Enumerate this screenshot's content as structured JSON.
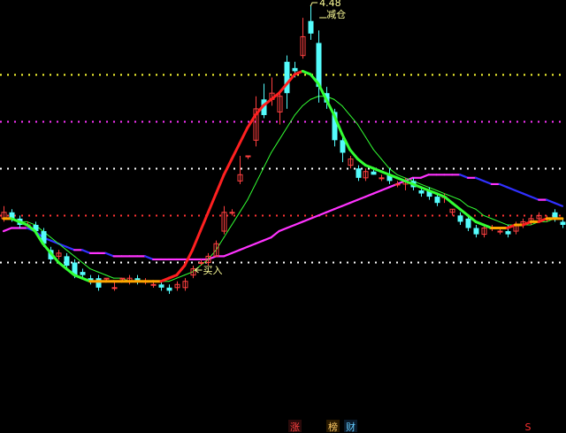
{
  "chart_data": {
    "type": "candlestick",
    "price_range": [
      3.3,
      4.48
    ],
    "annotations": {
      "high_price": "4.48",
      "sell_label": "减仓",
      "buy_label": "买入"
    },
    "guide_lines": [
      {
        "price": 4.26,
        "color": "#ffff33"
      },
      {
        "price": 4.11,
        "color": "#ff33ff"
      },
      {
        "price": 3.96,
        "color": "#ffffff"
      },
      {
        "price": 3.81,
        "color": "#ff3333"
      },
      {
        "price": 3.66,
        "color": "#ffffff"
      }
    ],
    "candles": [
      [
        3.8,
        3.82,
        3.79,
        3.84
      ],
      [
        3.82,
        3.8,
        3.79,
        3.83
      ],
      [
        3.8,
        3.78,
        3.77,
        3.81
      ],
      [
        3.78,
        3.78,
        3.77,
        3.79
      ],
      [
        3.78,
        3.76,
        3.75,
        3.79
      ],
      [
        3.76,
        3.72,
        3.71,
        3.77
      ],
      [
        3.7,
        3.67,
        3.66,
        3.71
      ],
      [
        3.68,
        3.69,
        3.67,
        3.7
      ],
      [
        3.68,
        3.65,
        3.64,
        3.69
      ],
      [
        3.66,
        3.62,
        3.61,
        3.67
      ],
      [
        3.63,
        3.62,
        3.61,
        3.64
      ],
      [
        3.61,
        3.6,
        3.59,
        3.62
      ],
      [
        3.61,
        3.58,
        3.57,
        3.62
      ],
      [
        3.61,
        3.61,
        3.6,
        3.61
      ],
      [
        3.58,
        3.58,
        3.57,
        3.6
      ],
      [
        3.61,
        3.61,
        3.6,
        3.61
      ],
      [
        3.6,
        3.61,
        3.59,
        3.62
      ],
      [
        3.61,
        3.6,
        3.59,
        3.62
      ],
      [
        3.6,
        3.6,
        3.59,
        3.61
      ],
      [
        3.59,
        3.59,
        3.58,
        3.6
      ],
      [
        3.59,
        3.58,
        3.57,
        3.6
      ],
      [
        3.58,
        3.57,
        3.56,
        3.59
      ],
      [
        3.58,
        3.59,
        3.57,
        3.6
      ],
      [
        3.58,
        3.6,
        3.57,
        3.61
      ],
      [
        3.62,
        3.64,
        3.61,
        3.65
      ],
      [
        3.66,
        3.66,
        3.65,
        3.67
      ],
      [
        3.66,
        3.68,
        3.65,
        3.69
      ],
      [
        3.68,
        3.72,
        3.68,
        3.73
      ],
      [
        3.76,
        3.82,
        3.75,
        3.84
      ],
      [
        3.82,
        3.82,
        3.81,
        3.83
      ],
      [
        3.92,
        3.94,
        3.91,
        4.0
      ],
      [
        4.0,
        4.0,
        3.99,
        4.0
      ],
      [
        4.05,
        4.15,
        4.03,
        4.19
      ],
      [
        4.18,
        4.13,
        4.12,
        4.23
      ],
      [
        4.18,
        4.2,
        4.16,
        4.25
      ],
      [
        4.14,
        4.19,
        4.1,
        4.2
      ],
      [
        4.3,
        4.2,
        4.15,
        4.32
      ],
      [
        4.28,
        4.27,
        4.25,
        4.3
      ],
      [
        4.32,
        4.38,
        4.31,
        4.44
      ],
      [
        4.43,
        4.39,
        4.37,
        4.48
      ],
      [
        4.36,
        4.22,
        4.17,
        4.4
      ],
      [
        4.2,
        4.17,
        4.15,
        4.22
      ],
      [
        4.14,
        4.05,
        4.03,
        4.15
      ],
      [
        4.05,
        4.01,
        3.98,
        4.06
      ],
      [
        3.97,
        3.99,
        3.96,
        4.0
      ],
      [
        3.96,
        3.93,
        3.92,
        3.97
      ],
      [
        3.93,
        3.95,
        3.92,
        3.96
      ],
      [
        3.95,
        3.94,
        3.94,
        3.96
      ],
      [
        3.93,
        3.93,
        3.92,
        3.94
      ],
      [
        3.94,
        3.92,
        3.91,
        3.96
      ],
      [
        3.91,
        3.91,
        3.9,
        3.92
      ],
      [
        3.91,
        3.92,
        3.89,
        3.93
      ],
      [
        3.92,
        3.9,
        3.89,
        3.93
      ],
      [
        3.89,
        3.88,
        3.87,
        3.9
      ],
      [
        3.89,
        3.87,
        3.86,
        3.9
      ],
      [
        3.87,
        3.85,
        3.84,
        3.88
      ],
      [
        3.87,
        3.87,
        3.85,
        3.88
      ],
      [
        3.82,
        3.83,
        3.81,
        3.83
      ],
      [
        3.81,
        3.79,
        3.78,
        3.82
      ],
      [
        3.8,
        3.77,
        3.76,
        3.81
      ],
      [
        3.77,
        3.75,
        3.74,
        3.78
      ],
      [
        3.75,
        3.77,
        3.74,
        3.78
      ],
      [
        3.77,
        3.77,
        3.76,
        3.78
      ],
      [
        3.76,
        3.76,
        3.75,
        3.77
      ],
      [
        3.76,
        3.75,
        3.74,
        3.78
      ],
      [
        3.76,
        3.78,
        3.75,
        3.79
      ],
      [
        3.78,
        3.79,
        3.77,
        3.8
      ],
      [
        3.79,
        3.8,
        3.78,
        3.81
      ],
      [
        3.8,
        3.81,
        3.79,
        3.82
      ],
      [
        3.8,
        3.8,
        3.79,
        3.81
      ],
      [
        3.82,
        3.8,
        3.79,
        3.83
      ],
      [
        3.79,
        3.78,
        3.77,
        3.8
      ]
    ],
    "ma_fast": [
      3.8,
      3.8,
      3.79,
      3.78,
      3.76,
      3.72,
      3.69,
      3.66,
      3.64,
      3.62,
      3.61,
      3.6,
      3.6,
      3.6,
      3.6,
      3.6,
      3.6,
      3.6,
      3.6,
      3.6,
      3.6,
      3.61,
      3.62,
      3.65,
      3.7,
      3.76,
      3.82,
      3.88,
      3.94,
      3.99,
      4.04,
      4.09,
      4.13,
      4.16,
      4.18,
      4.2,
      4.23,
      4.26,
      4.27,
      4.26,
      4.23,
      4.18,
      4.13,
      4.07,
      4.02,
      3.99,
      3.97,
      3.96,
      3.95,
      3.94,
      3.93,
      3.92,
      3.91,
      3.9,
      3.89,
      3.88,
      3.87,
      3.85,
      3.83,
      3.81,
      3.79,
      3.78,
      3.77,
      3.77,
      3.77,
      3.78,
      3.78,
      3.79,
      3.79,
      3.8,
      3.8,
      3.8
    ],
    "ma_mid": [
      3.8,
      3.8,
      3.79,
      3.79,
      3.78,
      3.76,
      3.74,
      3.72,
      3.7,
      3.68,
      3.66,
      3.64,
      3.63,
      3.62,
      3.61,
      3.61,
      3.6,
      3.6,
      3.6,
      3.6,
      3.6,
      3.6,
      3.61,
      3.62,
      3.63,
      3.65,
      3.67,
      3.7,
      3.74,
      3.78,
      3.82,
      3.86,
      3.91,
      3.96,
      4.01,
      4.05,
      4.09,
      4.13,
      4.16,
      4.18,
      4.19,
      4.19,
      4.18,
      4.16,
      4.13,
      4.1,
      4.06,
      4.02,
      3.99,
      3.96,
      3.94,
      3.93,
      3.92,
      3.91,
      3.9,
      3.89,
      3.88,
      3.87,
      3.86,
      3.84,
      3.83,
      3.81,
      3.8,
      3.79,
      3.78,
      3.78,
      3.78,
      3.78,
      3.79,
      3.79,
      3.8,
      3.8
    ],
    "ma_long": [
      3.76,
      3.77,
      3.77,
      3.77,
      3.76,
      3.74,
      3.73,
      3.72,
      3.71,
      3.7,
      3.7,
      3.69,
      3.69,
      3.69,
      3.68,
      3.68,
      3.68,
      3.68,
      3.68,
      3.67,
      3.67,
      3.67,
      3.67,
      3.67,
      3.67,
      3.67,
      3.67,
      3.68,
      3.68,
      3.69,
      3.7,
      3.71,
      3.72,
      3.73,
      3.74,
      3.76,
      3.77,
      3.78,
      3.79,
      3.8,
      3.81,
      3.82,
      3.83,
      3.84,
      3.85,
      3.86,
      3.87,
      3.88,
      3.89,
      3.9,
      3.91,
      3.92,
      3.93,
      3.93,
      3.94,
      3.94,
      3.94,
      3.94,
      3.94,
      3.93,
      3.93,
      3.92,
      3.91,
      3.91,
      3.9,
      3.89,
      3.88,
      3.87,
      3.86,
      3.86,
      3.85,
      3.84
    ]
  },
  "colors": {
    "background": "#000000",
    "candle_up": "#ff4040",
    "candle_down": "#54fcfc",
    "ma_fast_down": "#33ff33",
    "ma_fast_up": "#ff2020",
    "ma_fast_flat": "#ffa500",
    "ma_mid": "#33ff33",
    "ma_long_up": "#ff33ff",
    "ma_long_down": "#3030ff",
    "annotation": "#ffff99"
  },
  "footer": {
    "badge_up": "涨",
    "badge_list": "榜",
    "badge_fin": "财",
    "badge_s": "S"
  }
}
